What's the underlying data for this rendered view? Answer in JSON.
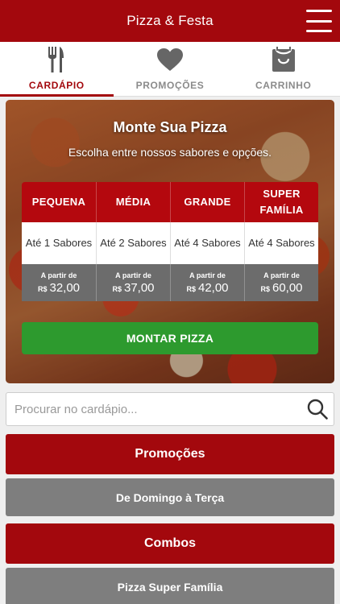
{
  "header": {
    "title": "Pizza & Festa",
    "menu_icon": "hamburger-icon"
  },
  "tabs": [
    {
      "label": "CARDÁPIO",
      "icon": "fork-knife-icon",
      "active": true
    },
    {
      "label": "PROMOÇÕES",
      "icon": "heart-icon",
      "active": false
    },
    {
      "label": "CARRINHO",
      "icon": "shopping-bag-icon",
      "active": false
    }
  ],
  "hero": {
    "title": "Monte Sua Pizza",
    "subtitle": "Escolha entre nossos sabores e opções.",
    "sizes": [
      {
        "name": "PEQUENA",
        "flavors": "Até 1 Sabores",
        "from": "A partir de",
        "currency": "R$",
        "price": "32,00"
      },
      {
        "name": "MÉDIA",
        "flavors": "Até 2 Sabores",
        "from": "A partir de",
        "currency": "R$",
        "price": "37,00"
      },
      {
        "name": "GRANDE",
        "flavors": "Até 4 Sabores",
        "from": "A partir de",
        "currency": "R$",
        "price": "42,00"
      },
      {
        "name": "SUPER FAMÍLIA",
        "flavors": "Até 4 Sabores",
        "from": "A partir de",
        "currency": "R$",
        "price": "60,00"
      }
    ],
    "button": "MONTAR PIZZA"
  },
  "search": {
    "placeholder": "Procurar no cardápio...",
    "value": "",
    "icon": "search-icon"
  },
  "categories": [
    {
      "label": "Promoções",
      "style": "primary"
    },
    {
      "label": "De Domingo à Terça",
      "style": "secondary"
    },
    {
      "label": "Combos",
      "style": "primary"
    },
    {
      "label": "Pizza Super Família",
      "style": "secondary"
    }
  ],
  "colors": {
    "brand_red": "#a3080d",
    "green_button": "#2d9a2e",
    "gray": "#7e7e7e"
  }
}
